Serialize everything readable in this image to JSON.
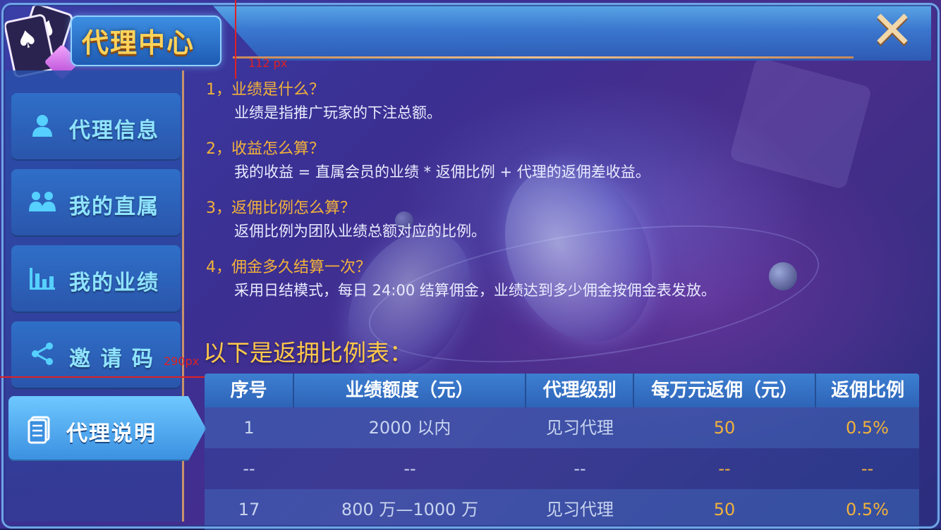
{
  "header": {
    "title": "代理中心",
    "close_icon": "close-icon"
  },
  "sidebar": {
    "items": [
      {
        "label": "代理信息",
        "icon": "person-icon",
        "active": false
      },
      {
        "label": "我的直属",
        "icon": "group-icon",
        "active": false
      },
      {
        "label": "我的业绩",
        "icon": "bar-chart-icon",
        "active": false
      },
      {
        "label": "邀 请 码",
        "icon": "share-icon",
        "active": false
      },
      {
        "label": "代理说明",
        "icon": "document-icon",
        "active": true
      }
    ]
  },
  "faq": [
    {
      "q": "1，业绩是什么？",
      "a": "业绩是指推广玩家的下注总额。"
    },
    {
      "q": "2，收益怎么算？",
      "a": "我的收益 = 直属会员的业绩 * 返佣比例 + 代理的返佣差收益。"
    },
    {
      "q": "3，返佣比例怎么算？",
      "a": "返佣比例为团队业绩总额对应的比例。"
    },
    {
      "q": "4，佣金多久结算一次？",
      "a": "采用日结模式，每日 24:00 结算佣金，业绩达到多少佣金按佣金表发放。"
    }
  ],
  "section_title": "以下是返拥比例表：",
  "table": {
    "headers": [
      "序号",
      "业绩额度（元）",
      "代理级别",
      "每万元返佣（元）",
      "返佣比例"
    ],
    "rows": [
      [
        "1",
        "2000 以内",
        "见习代理",
        "50",
        "0.5%"
      ],
      [
        "--",
        "--",
        "--",
        "--",
        "--"
      ],
      [
        "17",
        "800 万—1000 万",
        "见习代理",
        "50",
        "0.5%"
      ]
    ]
  },
  "annotations": {
    "marker_a": "112 px",
    "marker_b": "290px"
  },
  "colors": {
    "accent_gold": "#f2b23a",
    "title_gold": "#ffd35a",
    "nav_text": "#8fe4ff",
    "guide_red": "#e02020"
  }
}
